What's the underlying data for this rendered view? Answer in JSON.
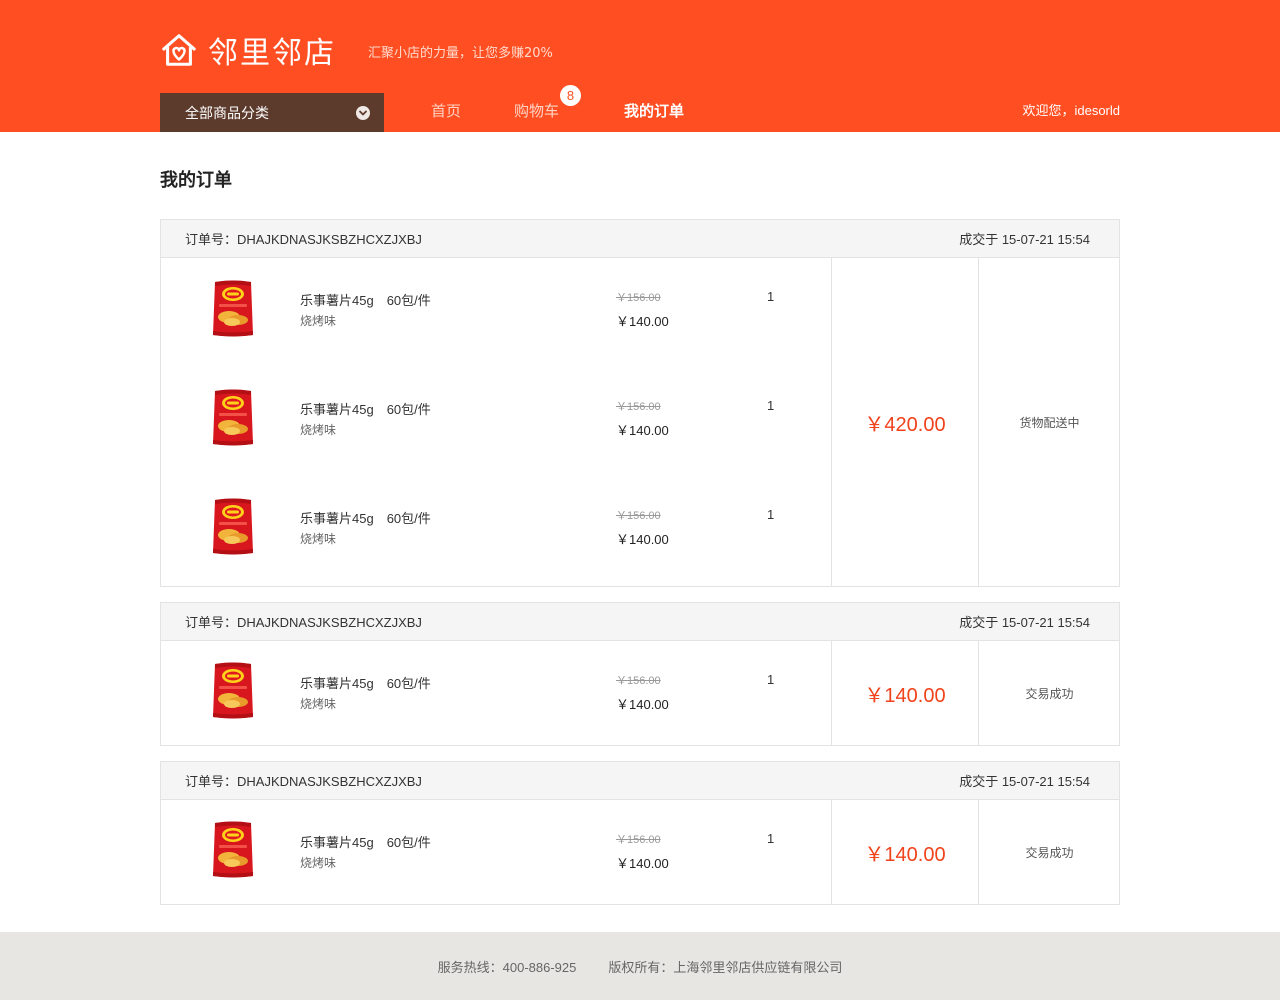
{
  "brand": {
    "name": "邻里邻店",
    "slogan": "汇聚小店的力量，让您多赚20%",
    "accent_color": "#ff4f22",
    "category_btn_color": "#5c3a2c",
    "price_color": "#f0421b"
  },
  "nav": {
    "category_label": "全部商品分类",
    "home_label": "首页",
    "cart_label": "购物车",
    "cart_count": "8",
    "orders_label": "我的订单",
    "welcome": "欢迎您，idesorld"
  },
  "page": {
    "title": "我的订单"
  },
  "orders": [
    {
      "order_no": "订单号：DHAJKDNASJKSBZHCXZJXBJ",
      "deal_time": "成交于 15-07-21 15:54",
      "total": "￥420.00",
      "status": "货物配送中",
      "items": [
        {
          "name": "乐事薯片45g　60包/件",
          "flavor": "烧烤味",
          "original_price": "￥156.00",
          "price": "￥140.00",
          "qty": "1",
          "image": "chips-bag-image"
        },
        {
          "name": "乐事薯片45g　60包/件",
          "flavor": "烧烤味",
          "original_price": "￥156.00",
          "price": "￥140.00",
          "qty": "1",
          "image": "chips-bag-image"
        },
        {
          "name": "乐事薯片45g　60包/件",
          "flavor": "烧烤味",
          "original_price": "￥156.00",
          "price": "￥140.00",
          "qty": "1",
          "image": "chips-bag-image"
        }
      ]
    },
    {
      "order_no": "订单号：DHAJKDNASJKSBZHCXZJXBJ",
      "deal_time": "成交于 15-07-21 15:54",
      "total": "￥140.00",
      "status": "交易成功",
      "items": [
        {
          "name": "乐事薯片45g　60包/件",
          "flavor": "烧烤味",
          "original_price": "￥156.00",
          "price": "￥140.00",
          "qty": "1",
          "image": "chips-bag-image"
        }
      ]
    },
    {
      "order_no": "订单号：DHAJKDNASJKSBZHCXZJXBJ",
      "deal_time": "成交于 15-07-21 15:54",
      "total": "￥140.00",
      "status": "交易成功",
      "items": [
        {
          "name": "乐事薯片45g　60包/件",
          "flavor": "烧烤味",
          "original_price": "￥156.00",
          "price": "￥140.00",
          "qty": "1",
          "image": "chips-bag-image"
        }
      ]
    }
  ],
  "footer": {
    "hotline": "服务热线：400-886-925",
    "copyright": "版权所有：上海邻里邻店供应链有限公司"
  }
}
